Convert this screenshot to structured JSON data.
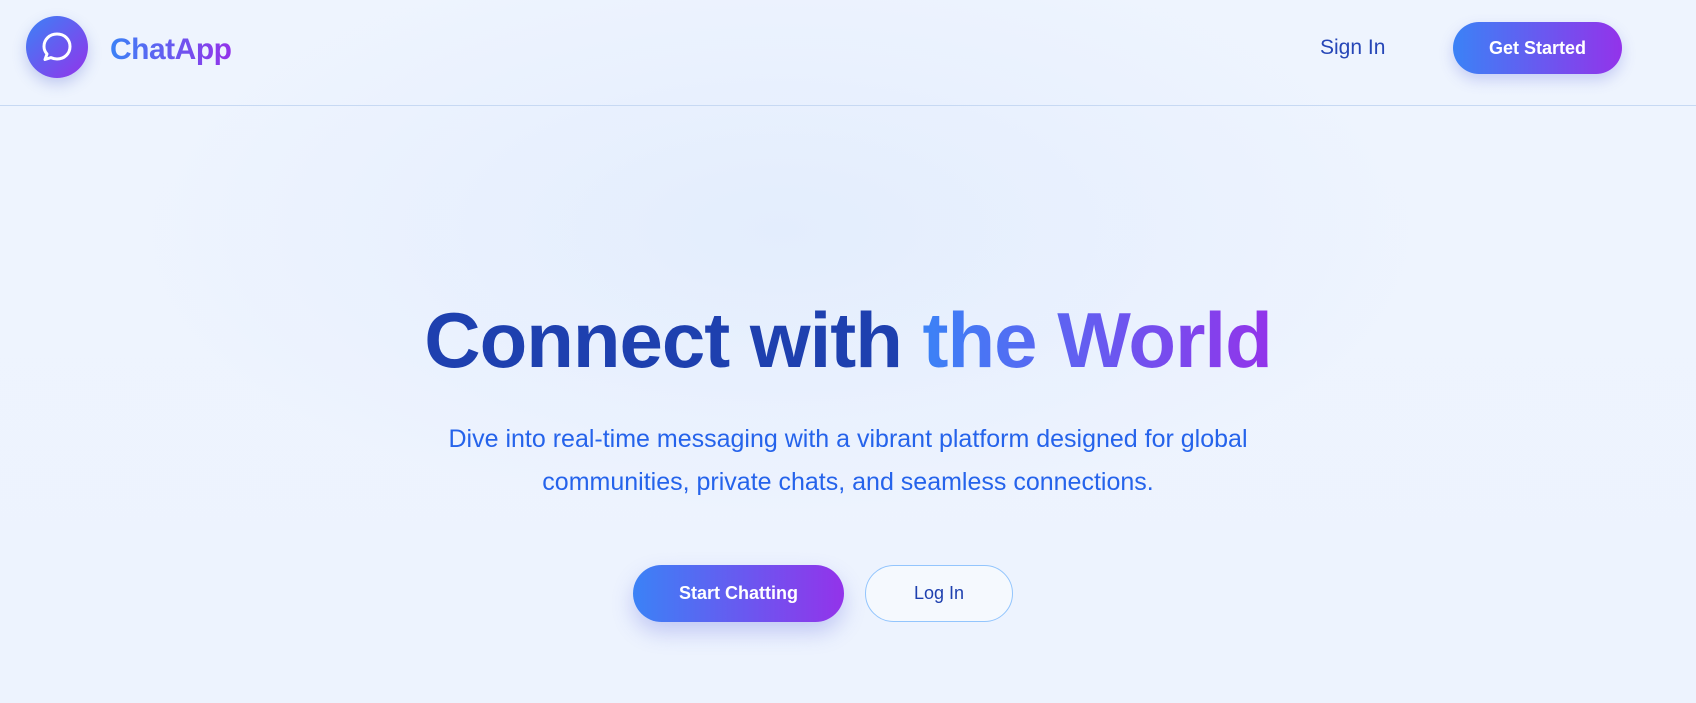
{
  "header": {
    "brand": "ChatApp",
    "logo_icon": "chat-bubble-icon",
    "sign_in_label": "Sign In",
    "get_started_label": "Get Started"
  },
  "hero": {
    "title_plain": "Connect with ",
    "title_accent": "the World",
    "subtitle_line1": "Dive into real-time messaging with a vibrant platform designed for global",
    "subtitle_line2": "communities, private chats, and seamless connections.",
    "primary_cta": "Start Chatting",
    "secondary_cta": "Log In"
  },
  "colors": {
    "gradient_start": "#3b82f6",
    "gradient_end": "#9333ea",
    "heading": "#1e40af",
    "body_text": "#2563eb",
    "background": "#eef4fe"
  }
}
